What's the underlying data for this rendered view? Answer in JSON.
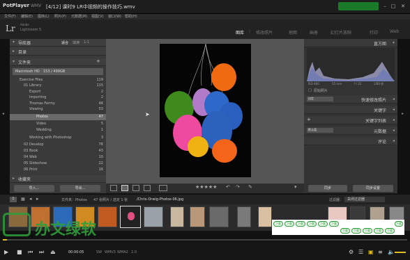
{
  "player": {
    "brand": "PotPlayer",
    "format": "WMV",
    "title": "[4/12] 课时9 LR中视频的操作技巧.wmv",
    "time_current": "00:00:05",
    "codec_tags": [
      "SW",
      "WMV3",
      "WMA2",
      "2.0"
    ],
    "progress_fraction": 0.01
  },
  "lr_menu": [
    "文件(F)",
    "编辑(E)",
    "图库(L)",
    "照片(P)",
    "元数据(M)",
    "视图(V)",
    "窗口(W)",
    "帮助(H)"
  ],
  "lr_header": {
    "logo": "Lr",
    "subtitle_top": "Adobe",
    "subtitle": "Lightroom 5",
    "modules": [
      "图库",
      "修改照片",
      "地图",
      "画册",
      "幻灯片放映",
      "打印",
      "Web"
    ],
    "active_module": "图库"
  },
  "left_panel": {
    "navigator": {
      "title": "导航器",
      "fit": "适合",
      "fill": "填满",
      "ratio": "1:1"
    },
    "catalog": {
      "title": "目录"
    },
    "folders": {
      "title": "文件夹",
      "drive": "Macintosh HD",
      "drive_info": "153 / 499GB",
      "items": [
        {
          "label": "Exercise Files",
          "count": "119"
        },
        {
          "label": "01 Library",
          "count": "115"
        },
        {
          "label": "Export",
          "count": "2"
        },
        {
          "label": "Importing",
          "count": "2"
        },
        {
          "label": "Thomas Fermy",
          "count": "46"
        },
        {
          "label": "Viewing",
          "count": "53"
        },
        {
          "label": "Photos",
          "count": "47"
        },
        {
          "label": "Video",
          "count": "5"
        },
        {
          "label": "Wedding",
          "count": "1"
        },
        {
          "label": "Working with Photoshop",
          "count": "3"
        },
        {
          "label": "02 Develop",
          "count": "76"
        },
        {
          "label": "03 Book",
          "count": "43"
        },
        {
          "label": "04 Web",
          "count": "10"
        },
        {
          "label": "05 Slideshow",
          "count": "22"
        },
        {
          "label": "06 Print",
          "count": "16"
        }
      ]
    },
    "collections": {
      "title": "收藏夹"
    },
    "import_button": "导入...",
    "export_button": "导出..."
  },
  "right_panel": {
    "histogram": {
      "title": "直方图",
      "values": [
        "ISO 400",
        "55 mm",
        "f / 22",
        "1/80 秒"
      ],
      "original": "原始照片"
    },
    "quick_develop": {
      "title": "快速修改照片",
      "preset": "自定"
    },
    "keywords": {
      "title": "关键字"
    },
    "keyword_list": {
      "title": "关键字列表"
    },
    "metadata": {
      "title": "元数据",
      "preset": "默认值"
    },
    "comments": {
      "title": "评论"
    },
    "sync_button": "同步",
    "sync_settings_button": "同步设置"
  },
  "toolbar": {
    "stars": "★★★★★"
  },
  "filmstrip_bar": {
    "page_label": "1",
    "info": "文件夹：Photos",
    "count": "47 张照片 / 选定 1 张",
    "filename": "/Chris-Orwig-Photos-06.jpg",
    "filter_label": "过滤器：",
    "filter_value": "关闭过滤器"
  },
  "watermark": {
    "text": "办文绿软"
  },
  "overlay_links": [
    "下载",
    "下载",
    "下载",
    "下载",
    "下载",
    "下载",
    "下载",
    "下载",
    "下载",
    "下载",
    "下载",
    "下载"
  ],
  "colors": {
    "brand_green": "#2e9e3a",
    "lr_panel": "#3a3a3a",
    "accent_yellow": "#e0c020"
  }
}
